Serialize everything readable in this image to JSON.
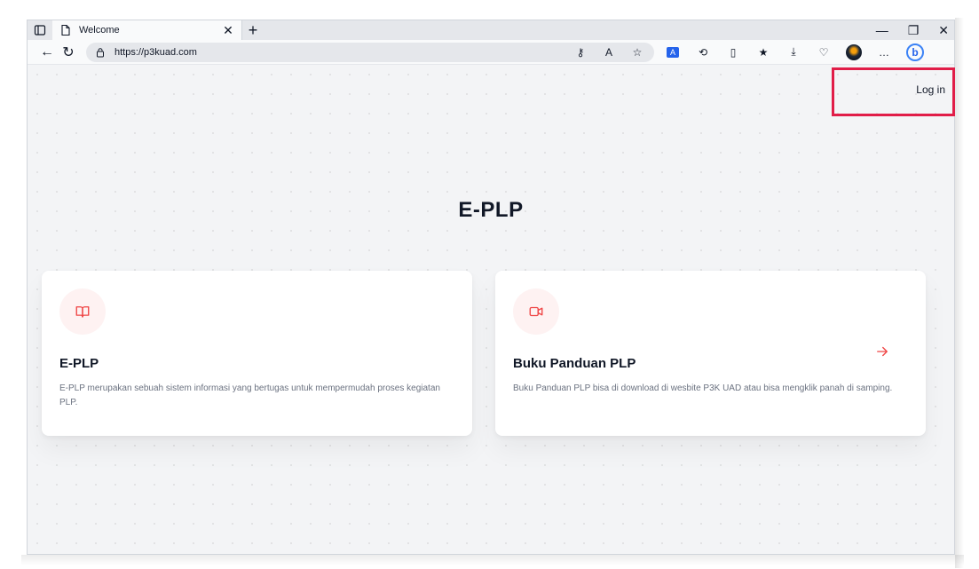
{
  "browser": {
    "tab_title": "Welcome",
    "url": "https://p3kuad.com"
  },
  "page": {
    "login_label": "Log in",
    "heading": "E-PLP",
    "cards": [
      {
        "title": "E-PLP",
        "description": "E-PLP merupakan sebuah sistem informasi yang bertugas untuk mempermudah proses kegiatan PLP.",
        "icon": "book-open-icon"
      },
      {
        "title": "Buku Panduan PLP",
        "description": "Buku Panduan PLP bisa di download di wesbite P3K UAD atau bisa mengklik panah di samping.",
        "icon": "video-camera-icon",
        "link_icon": "arrow-right-icon"
      }
    ]
  },
  "colors": {
    "accent_red": "#ef4444",
    "icon_bg": "#fef2f2",
    "highlight_box": "#e11d48"
  }
}
